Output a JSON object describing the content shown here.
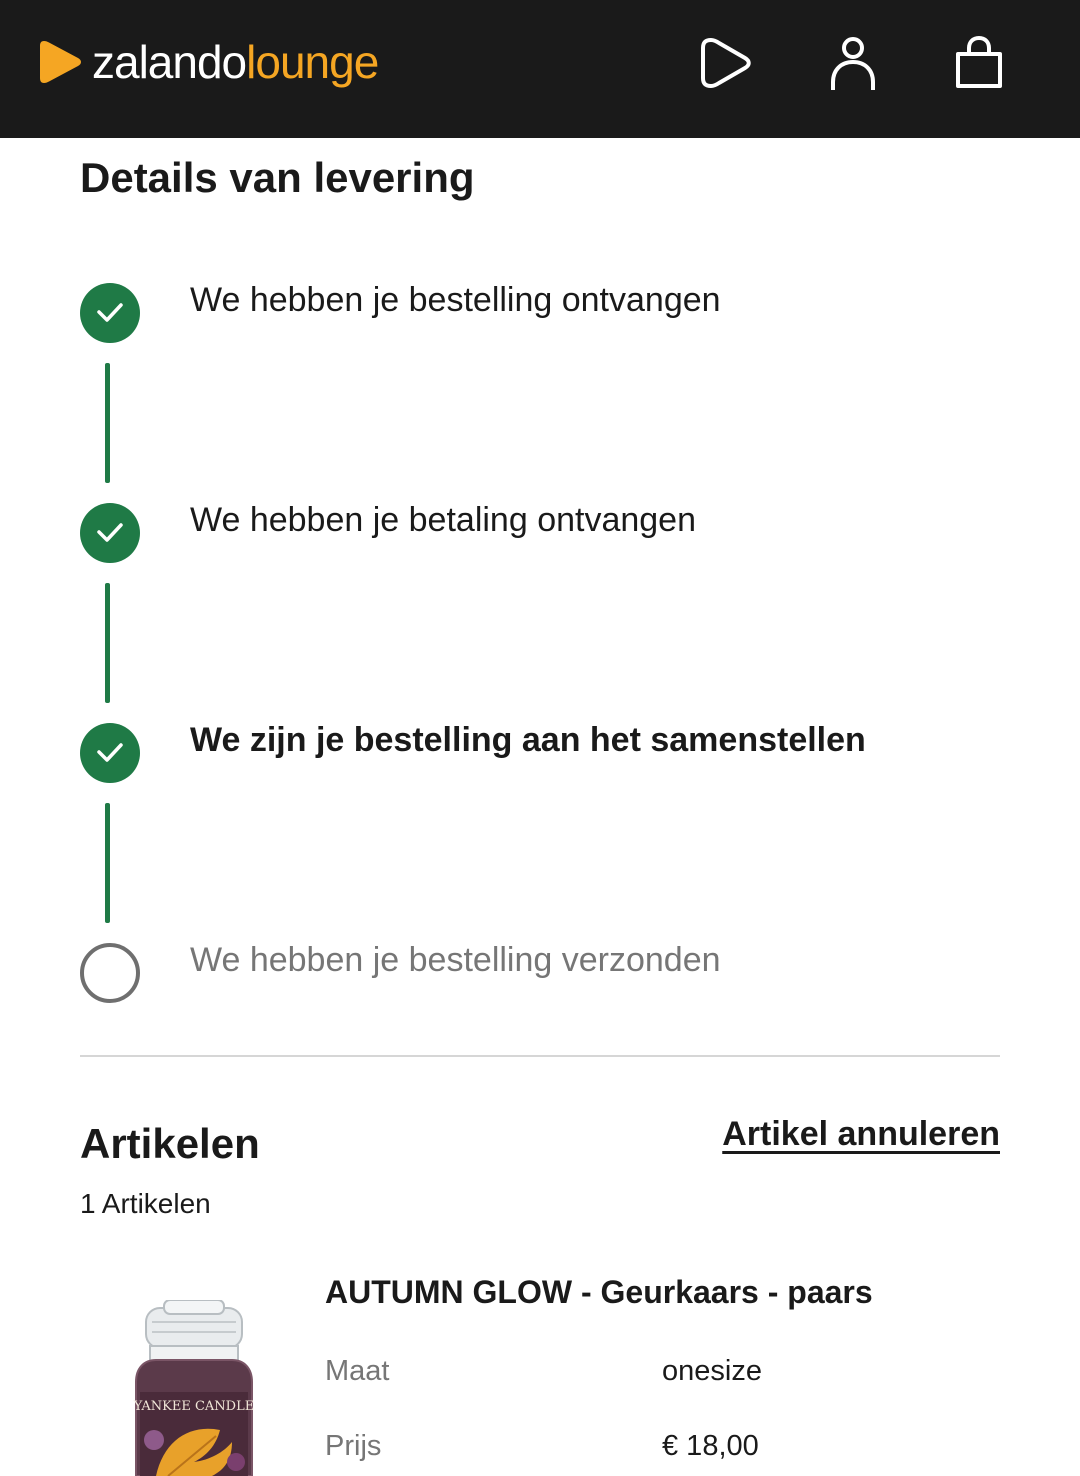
{
  "header": {
    "brand_part1": "zalando",
    "brand_part2": "lounge",
    "brand_color": "#f5a623",
    "icons": [
      "play-icon",
      "user-icon",
      "shopping-bag-icon"
    ]
  },
  "page_title": "Details van levering",
  "timeline": {
    "accent_color": "#1f7a46",
    "steps": [
      {
        "label": "We hebben je bestelling ontvangen",
        "status": "done"
      },
      {
        "label": "We hebben je betaling ontvangen",
        "status": "done"
      },
      {
        "label": "We zijn je bestelling aan het samenstellen",
        "status": "current"
      },
      {
        "label": "We hebben je bestelling verzonden",
        "status": "pending"
      }
    ]
  },
  "articles": {
    "title": "Artikelen",
    "cancel_label": "Artikel annuleren",
    "count_text": "1 Artikelen",
    "items": [
      {
        "name": "AUTUMN GLOW - Geurkaars - paars",
        "size_label": "Maat",
        "size_value": "onesize",
        "price_label": "Prijs",
        "price_value": "€ 18,00",
        "image_brand": "YANKEE CANDLE"
      }
    ]
  }
}
